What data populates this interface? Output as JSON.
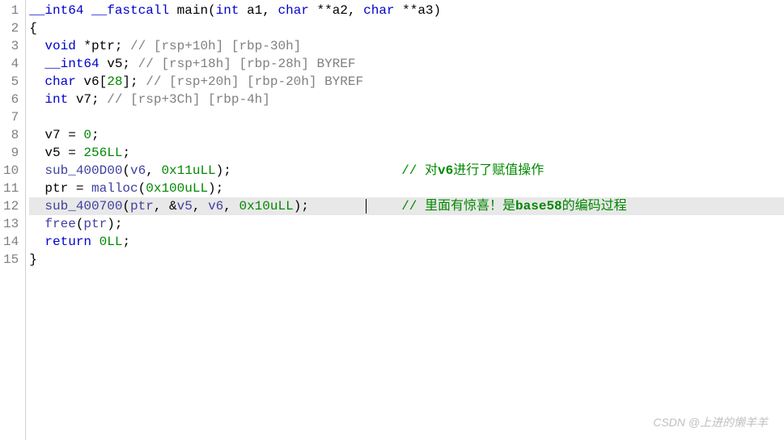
{
  "lines": {
    "count": 15
  },
  "code": {
    "l1_type1": "__int64",
    "l1_kw": " __fastcall ",
    "l1_fn": "main",
    "l1_p1": "(",
    "l1_type2": "int",
    "l1_a1": " a1, ",
    "l1_type3": "char",
    "l1_a2": " **a2, ",
    "l1_type4": "char",
    "l1_a3": " **a3)",
    "l2": "{",
    "l3_ind": "  ",
    "l3_type": "void",
    "l3_rest": " *ptr; ",
    "l3_cmt": "// [rsp+10h] [rbp-30h]",
    "l4_ind": "  ",
    "l4_type": "__int64",
    "l4_rest": " v5; ",
    "l4_cmt": "// [rsp+18h] [rbp-28h] BYREF",
    "l5_ind": "  ",
    "l5_type": "char",
    "l5_rest": " v6[",
    "l5_num": "28",
    "l5_rest2": "]; ",
    "l5_cmt": "// [rsp+20h] [rbp-20h] BYREF",
    "l6_ind": "  ",
    "l6_type": "int",
    "l6_rest": " v7; ",
    "l6_cmt": "// [rsp+3Ch] [rbp-4h]",
    "l7": "",
    "l8_ind": "  v7 = ",
    "l8_num": "0",
    "l8_end": ";",
    "l9_ind": "  v5 = ",
    "l9_num": "256LL",
    "l9_end": ";",
    "l10_ind": "  ",
    "l10_fn": "sub_400D00",
    "l10_p1": "(",
    "l10_v1": "v6",
    "l10_c1": ", ",
    "l10_num": "0x11uLL",
    "l10_end": ");",
    "l10_cmt_slash": "// ",
    "l10_cmt_txt1": "对",
    "l10_cmt_bold": "v6",
    "l10_cmt_txt2": "进行了赋值操作",
    "l11_ind": "  ptr = ",
    "l11_fn": "malloc",
    "l11_p1": "(",
    "l11_num": "0x100uLL",
    "l11_end": ");",
    "l12_ind": "  ",
    "l12_fn": "sub_400700",
    "l12_p1": "(",
    "l12_v1": "ptr",
    "l12_c1": ", &",
    "l12_v2": "v5",
    "l12_c2": ", ",
    "l12_v3": "v6",
    "l12_c3": ", ",
    "l12_num": "0x10uLL",
    "l12_end": ");",
    "l12_cmt_slash": "// ",
    "l12_cmt_txt1": "里面有惊喜！是",
    "l12_cmt_bold": "base58",
    "l12_cmt_txt2": "的编码过程",
    "l13_ind": "  ",
    "l13_fn": "free",
    "l13_p1": "(",
    "l13_v1": "ptr",
    "l13_end": ");",
    "l14_ind": "  ",
    "l14_kw": "return",
    "l14_sp": " ",
    "l14_num": "0LL",
    "l14_end": ";",
    "l15": "}"
  },
  "watermark": "CSDN @上进的懒羊羊"
}
